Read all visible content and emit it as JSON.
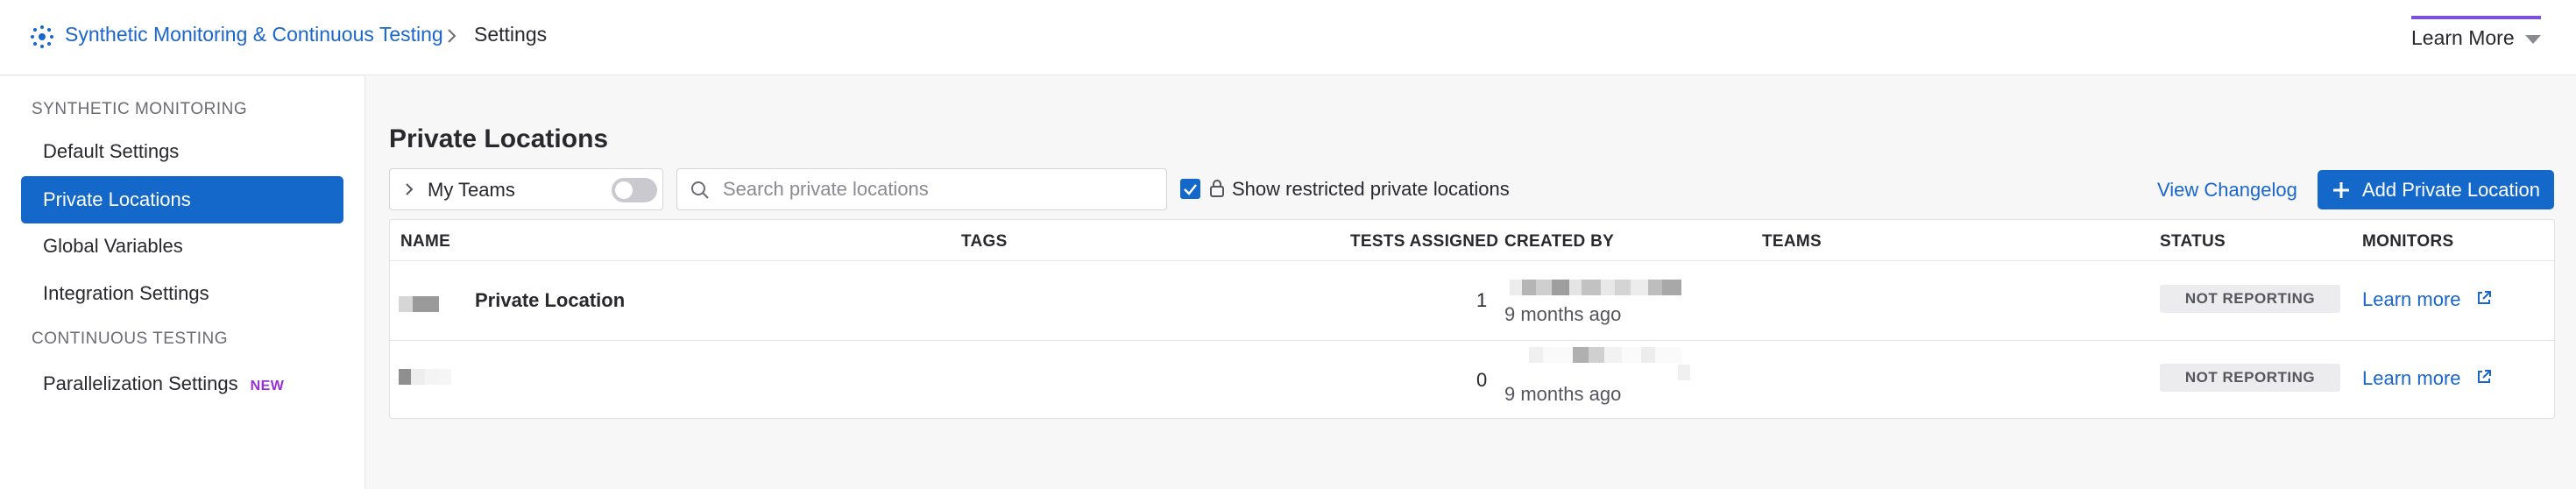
{
  "breadcrumb": {
    "product": "Synthetic Monitoring & Continuous Testing",
    "current": "Settings"
  },
  "header": {
    "learn_more": "Learn More",
    "accent_color": "#7b52dd"
  },
  "sidebar": {
    "section_monitoring": "SYNTHETIC MONITORING",
    "section_testing": "CONTINUOUS TESTING",
    "items": [
      {
        "label": "Default Settings"
      },
      {
        "label": "Private Locations",
        "active": true
      },
      {
        "label": "Global Variables"
      },
      {
        "label": "Integration Settings"
      },
      {
        "label": "Parallelization Settings",
        "badge": "NEW"
      }
    ]
  },
  "main": {
    "title": "Private Locations",
    "teams_filter_label": "My Teams",
    "teams_toggle_on": false,
    "search_placeholder": "Search private locations",
    "search_value": "",
    "show_restricted_checked": true,
    "show_restricted_label": "Show restricted private locations",
    "view_changelog": "View Changelog",
    "add_button": "Add Private Location",
    "primary_color": "#1468c9"
  },
  "table": {
    "columns": [
      "NAME",
      "TAGS",
      "TESTS ASSIGNED",
      "CREATED BY",
      "TEAMS",
      "STATUS",
      "MONITORS"
    ],
    "rows": [
      {
        "name": "Private Location",
        "tests_assigned": "1",
        "created_ago": "9 months ago",
        "status": "NOT REPORTING",
        "monitor_link": "Learn more"
      },
      {
        "name": "",
        "tests_assigned": "0",
        "created_ago": "9 months ago",
        "status": "NOT REPORTING",
        "monitor_link": "Learn more"
      }
    ]
  }
}
